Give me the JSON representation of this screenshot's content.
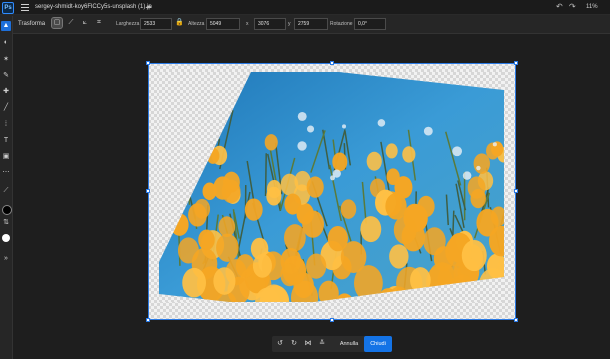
{
  "app": {
    "logo": "Ps",
    "document_title": "sergey-shmidt-koy6FlCCy5s-unsplash (1).jp",
    "zoom": "11%"
  },
  "options": {
    "title": "Trasforma",
    "width_label": "Larghezza",
    "width_value": "2533",
    "height_label": "Altezza",
    "height_value": "5049",
    "x_label": "x",
    "x_value": "3076",
    "y_label": "y",
    "y_value": "2759",
    "rotation_label": "Rotazione",
    "rotation_value": "0,0°"
  },
  "tools": {
    "icons": [
      "select-icon",
      "object-select-icon",
      "magic-wand-icon",
      "brush-icon",
      "healing-icon",
      "paintbrush-icon",
      "lasso-icon",
      "type-icon",
      "shape-icon",
      "eyedropper-icon",
      "layers-icon",
      "more-icon"
    ],
    "foreground_color": "#000000",
    "background_color": "#ffffff"
  },
  "actions": {
    "cancel_label": "Annulla",
    "done_label": "Chiudi"
  },
  "colors": {
    "accent": "#1473e6",
    "selection": "#2c7be5",
    "sky": "#2a86c4",
    "petal": "#f5a623"
  }
}
